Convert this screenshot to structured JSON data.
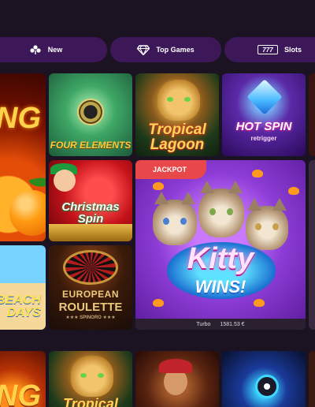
{
  "categories": {
    "new_label": "New",
    "top_label": "Top Games",
    "slots_label": "Slots",
    "slots_icon_text": "777"
  },
  "games": {
    "four_elements": "FOUR ELEMENTS",
    "tropical_lagoon": "Tropical Lagoon",
    "hot_spin": "HOT SPIN",
    "hot_spin_sub": "retrigger",
    "christmas_spin": "Christmas Spin",
    "kitty_title": "Kitty",
    "kitty_wins": "WINS!",
    "jackpot_badge": "JACKPOT",
    "kitty_footer_provider": "Turbo",
    "kitty_footer_amount": "1581.53 €",
    "euro_roulette_1": "EUROPEAN",
    "euro_roulette_2": "ROULETTE",
    "euro_roulette_provider": "★★★ SPINORO ★★★",
    "orange_partial": "NG",
    "beach_partial": "BEACH DAYS",
    "tropical_lagoon_2": "Tropical"
  },
  "colors": {
    "background": "#1b1322",
    "pill": "#3c1858",
    "jackpot": "#e8484a"
  },
  "icons": {
    "new": "clover-icon",
    "top": "diamond-icon",
    "slots": "slots-777-icon"
  }
}
